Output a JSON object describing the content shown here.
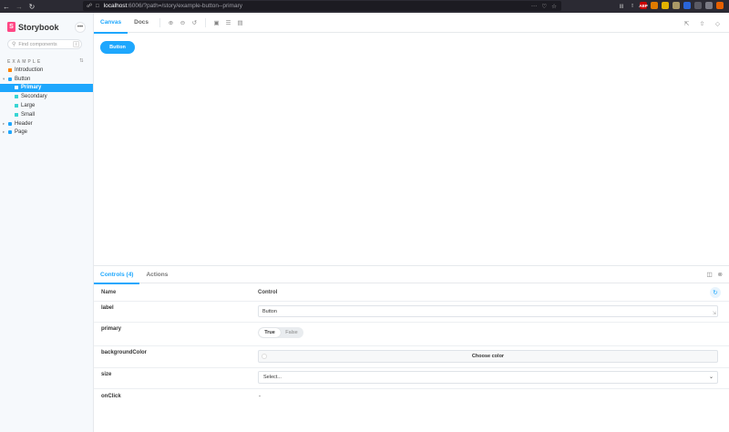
{
  "browser": {
    "url_host": "localhost",
    "url_path": ":6006/?path=/story/example-button--primary",
    "extensions": [
      {
        "name": "abp",
        "label": "ABP",
        "color": "#c00"
      },
      {
        "name": "ext2",
        "label": "",
        "color": "#e07b00"
      },
      {
        "name": "ext3",
        "label": "",
        "color": "#e2b200"
      },
      {
        "name": "ext4",
        "label": "",
        "color": "#a96"
      },
      {
        "name": "ext5",
        "label": "",
        "color": "#2a65d9"
      },
      {
        "name": "ext6",
        "label": "",
        "color": "#5a5a64"
      },
      {
        "name": "ext7",
        "label": "",
        "color": "#7b7b85"
      },
      {
        "name": "ext8",
        "label": "",
        "color": "#e66000"
      }
    ]
  },
  "sidebar": {
    "brand": "Storybook",
    "search_placeholder": "Find components",
    "search_shortcut": "/",
    "section": "EXAMPLE",
    "items": [
      {
        "label": "Introduction",
        "kind": "doc",
        "depth": 0
      },
      {
        "label": "Button",
        "kind": "comp",
        "depth": 0,
        "expanded": true
      },
      {
        "label": "Primary",
        "kind": "story",
        "depth": 1,
        "selected": true
      },
      {
        "label": "Secondary",
        "kind": "story",
        "depth": 1
      },
      {
        "label": "Large",
        "kind": "story",
        "depth": 1
      },
      {
        "label": "Small",
        "kind": "story",
        "depth": 1
      },
      {
        "label": "Header",
        "kind": "comp",
        "depth": 0
      },
      {
        "label": "Page",
        "kind": "comp",
        "depth": 0
      }
    ]
  },
  "toolbar": {
    "tabs": [
      "Canvas",
      "Docs"
    ],
    "active_tab": "Canvas"
  },
  "canvas": {
    "button_label": "Button"
  },
  "addons": {
    "tabs": [
      "Controls (4)",
      "Actions"
    ],
    "active_tab": "Controls (4)",
    "columns": {
      "name": "Name",
      "control": "Control"
    },
    "rows": {
      "label": {
        "name": "label",
        "value": "Button"
      },
      "primary": {
        "name": "primary",
        "true_label": "True",
        "false_label": "False"
      },
      "backgroundColor": {
        "name": "backgroundColor",
        "button": "Choose color"
      },
      "size": {
        "name": "size",
        "placeholder": "Select..."
      },
      "onClick": {
        "name": "onClick",
        "value": "-"
      }
    }
  },
  "colors": {
    "accent": "#1ea7fd",
    "brand": "#ff4785"
  }
}
